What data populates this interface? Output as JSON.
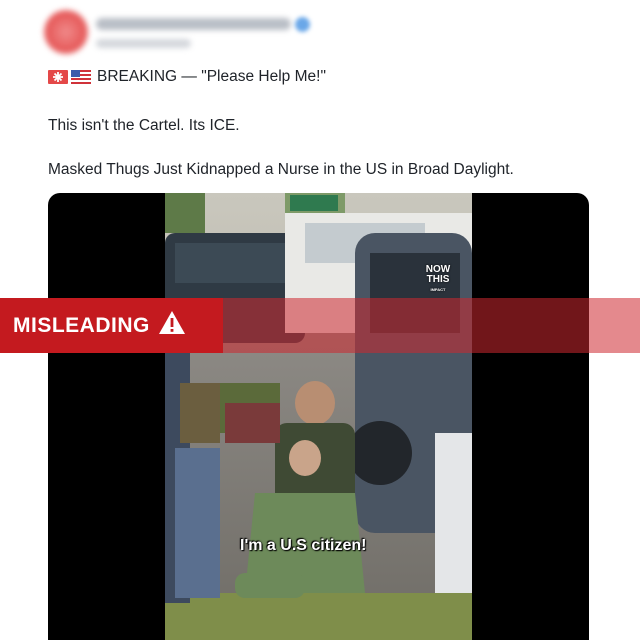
{
  "post": {
    "icons": [
      "siren-icon",
      "us-flag-icon"
    ],
    "headline": "BREAKING — \"Please Help Me!\"",
    "line2": "This isn't the Cartel. Its ICE.",
    "line3": "Masked Thugs Just Kidnapped a Nurse in the US in Broad Daylight."
  },
  "video": {
    "caption": "I'm a U.S citizen!",
    "watermark_top": "NOW",
    "watermark_mid": "THIS",
    "watermark_sub": "IMPACT"
  },
  "overlay": {
    "label": "MISLEADING",
    "icon": "warning-icon",
    "color": "#c41a1f"
  }
}
